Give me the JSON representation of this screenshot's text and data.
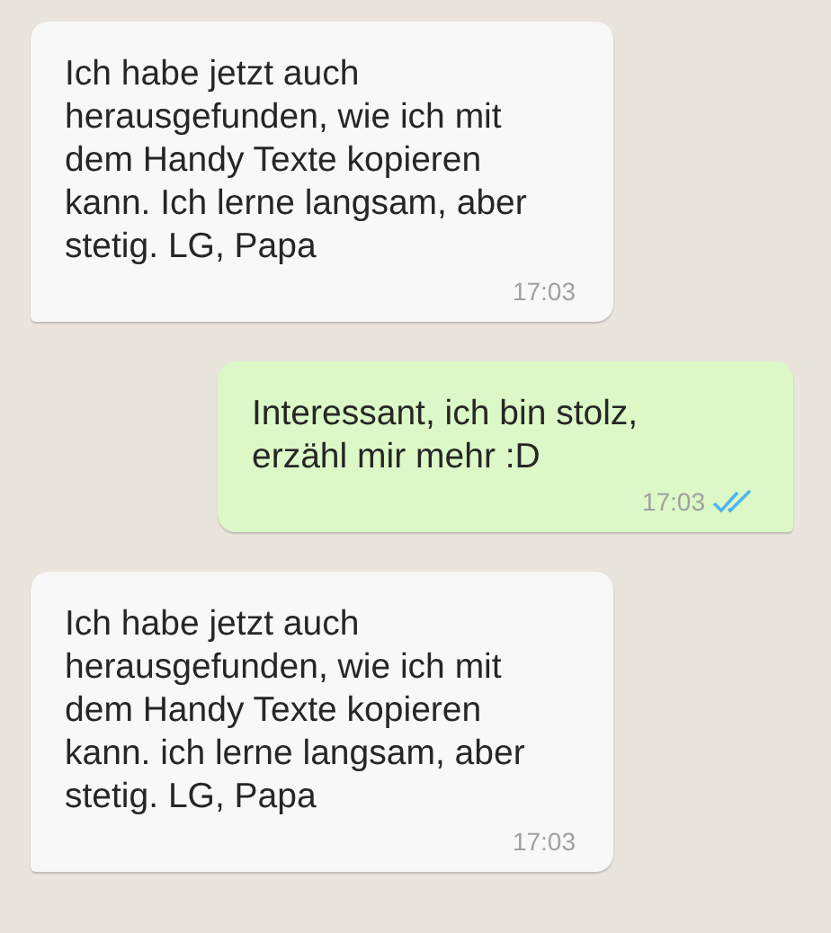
{
  "messages": [
    {
      "kind": "incoming",
      "text": "Ich habe jetzt auch herausgefunden, wie ich mit dem Handy Texte kopieren kann. Ich lerne langsam, aber stetig. LG, Papa",
      "time": "17:03"
    },
    {
      "kind": "outgoing",
      "text": "Interessant, ich bin stolz, erzähl mir mehr :D",
      "time": "17:03",
      "read": true
    },
    {
      "kind": "incoming",
      "text": "Ich habe jetzt auch herausgefunden, wie ich mit dem Handy Texte kopieren kann. ich lerne langsam, aber stetig. LG, Papa",
      "time": "17:03"
    }
  ]
}
